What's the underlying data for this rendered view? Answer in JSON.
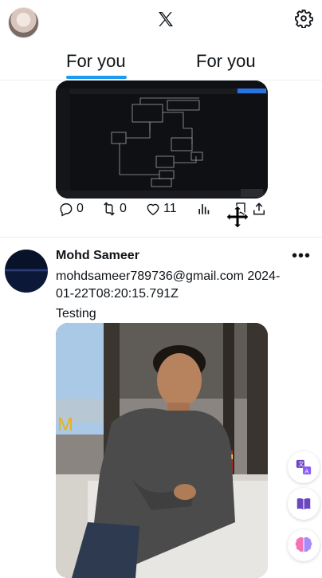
{
  "tabs": [
    "For you",
    "For you"
  ],
  "post1": {
    "replies": "0",
    "reposts": "0",
    "likes": "11"
  },
  "post2": {
    "name": "Mohd Sameer",
    "meta": "mohdsameer789736@gmail.com 2024-01-22T08:20:15.791Z",
    "text": "Testing"
  },
  "icons": {
    "logo": "x-logo-icon",
    "settings": "gear-icon",
    "reply": "speech-bubble-icon",
    "repost": "repost-icon",
    "like": "heart-icon",
    "views": "bar-chart-icon",
    "bookmark": "bookmark-icon",
    "share": "upload-icon",
    "more": "more-horizontal-icon",
    "translate": "translate-icon",
    "reader": "book-icon",
    "brain": "brain-icon",
    "cursor": "move-cursor-icon"
  },
  "colors": {
    "accent": "#1d9bf0",
    "text": "#0f1419",
    "muted": "#536471"
  }
}
